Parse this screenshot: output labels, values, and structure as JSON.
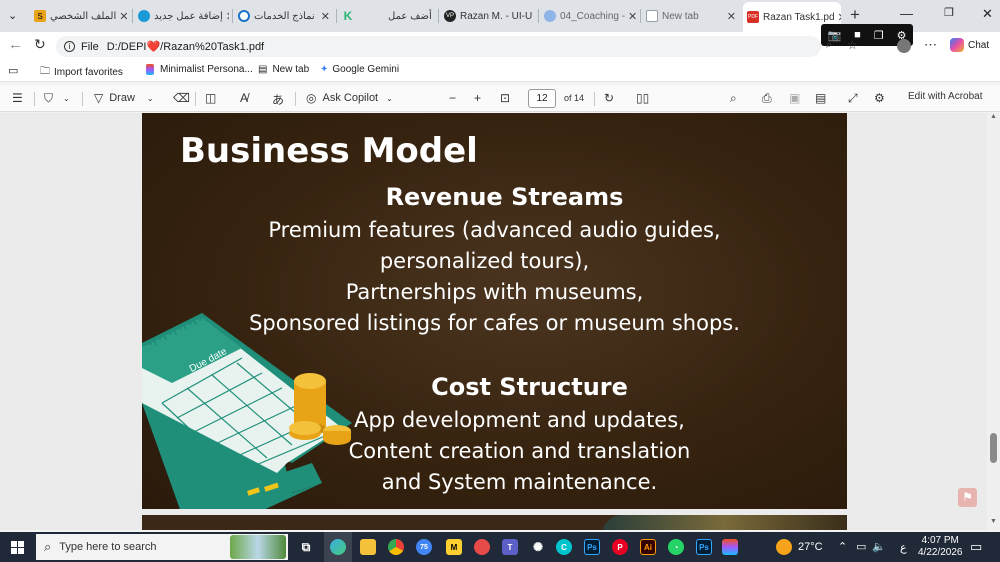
{
  "browser": {
    "tabs": [
      {
        "title": "الملف الشخصي",
        "favicon": "S",
        "favicon_color": "#e8a317"
      },
      {
        "title": "إضافة عمل جديد",
        "favicon": "",
        "favicon_color": "#1a9ad6"
      },
      {
        "title": "نماذج الخدمات",
        "favicon": "",
        "favicon_color": "#1a73c8"
      },
      {
        "title": "أضف عمل",
        "favicon": "K",
        "favicon_color": "#2bb673"
      },
      {
        "title": "Razan M. - UI-U",
        "favicon": "VP",
        "favicon_color": "#222222"
      },
      {
        "title": "04_Coaching -",
        "favicon": "",
        "favicon_color": "#8fb5e8"
      },
      {
        "title": "New tab",
        "favicon": "",
        "favicon_color": "#9aa0a6"
      },
      {
        "title": "Razan Task1.pd",
        "favicon": "PDF",
        "favicon_color": "#d93025"
      }
    ],
    "new_tab_label": "+",
    "address": {
      "scheme": "File",
      "path": "D:/DEPI❤️/Razan%20Task1.pdf"
    },
    "copilot_label": "Chat",
    "favorites": [
      {
        "label": "Import favorites"
      },
      {
        "label": "Minimalist Persona..."
      },
      {
        "label": "New tab"
      },
      {
        "label": "Google Gemini"
      }
    ]
  },
  "pdf_toolbar": {
    "draw_label": "Draw",
    "ask_copilot_label": "Ask Copilot",
    "page_current": "12",
    "page_total": "of 14",
    "edit_label": "Edit with Acrobat"
  },
  "slide": {
    "title": "Business Model",
    "section1_heading": "Revenue Streams",
    "section1_lines": [
      "Premium features (advanced audio guides,",
      "personalized tours),",
      "Partnerships with museums,",
      "Sponsored listings for cafes or museum shops."
    ],
    "section2_heading": "Cost Structure",
    "section2_lines": [
      "App development and updates,",
      "Content creation and translation",
      "and System maintenance."
    ],
    "calendar_label": "Due date"
  },
  "taskbar": {
    "search_placeholder": "Type here to search",
    "weather": "27°C",
    "lang": "ع",
    "time": "4:07 PM",
    "date": "4/22/2026",
    "badges": {
      "chrome": "75",
      "teams": "1",
      "notif": "1"
    }
  }
}
